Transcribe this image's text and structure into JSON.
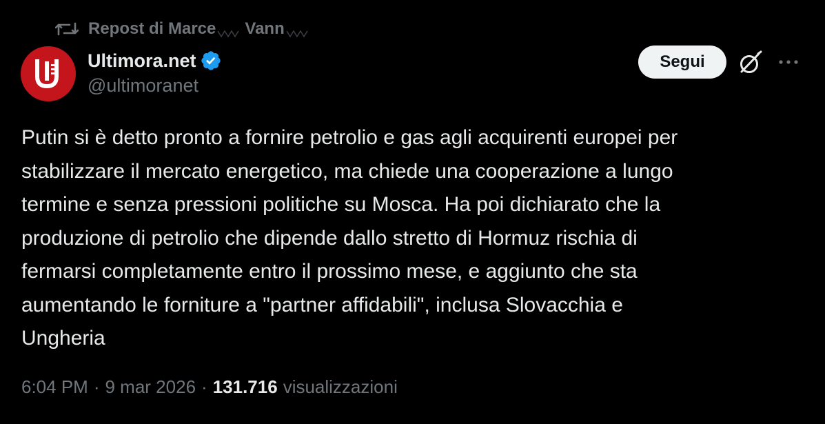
{
  "repost": {
    "label": "Repost di Marce",
    "label_suffix": "Vann",
    "icon": "repost-icon"
  },
  "author": {
    "display_name": "Ultimora.net",
    "handle": "@ultimoranet",
    "verified": true,
    "avatar_color": "#c4151c"
  },
  "actions": {
    "follow_label": "Segui",
    "grok_icon": "grok-icon",
    "more_icon": "more-icon"
  },
  "tweet": {
    "text": "Putin si è detto pronto a fornire petrolio e gas agli acquirenti europei per\nstabilizzare il mercato energetico, ma chiede una cooperazione a lungo\ntermine e senza pressioni politiche su Mosca. Ha poi dichiarato che la\nproduzione di petrolio che dipende dallo stretto di Hormuz rischia di\nfermarsi completamente entro il prossimo mese, e aggiunto che sta\naumentando le forniture a \"partner affidabili\", inclusa Slovacchia e\nUngheria"
  },
  "meta": {
    "time": "6:04 PM",
    "separator": "·",
    "date": "9 mar 2026",
    "views_count": "131.716",
    "views_label": "visualizzazioni"
  },
  "colors": {
    "background": "#000000",
    "text": "#e7e9ea",
    "secondary": "#71767b",
    "verified_blue": "#1d9bf0",
    "button_bg": "#eff3f4"
  }
}
